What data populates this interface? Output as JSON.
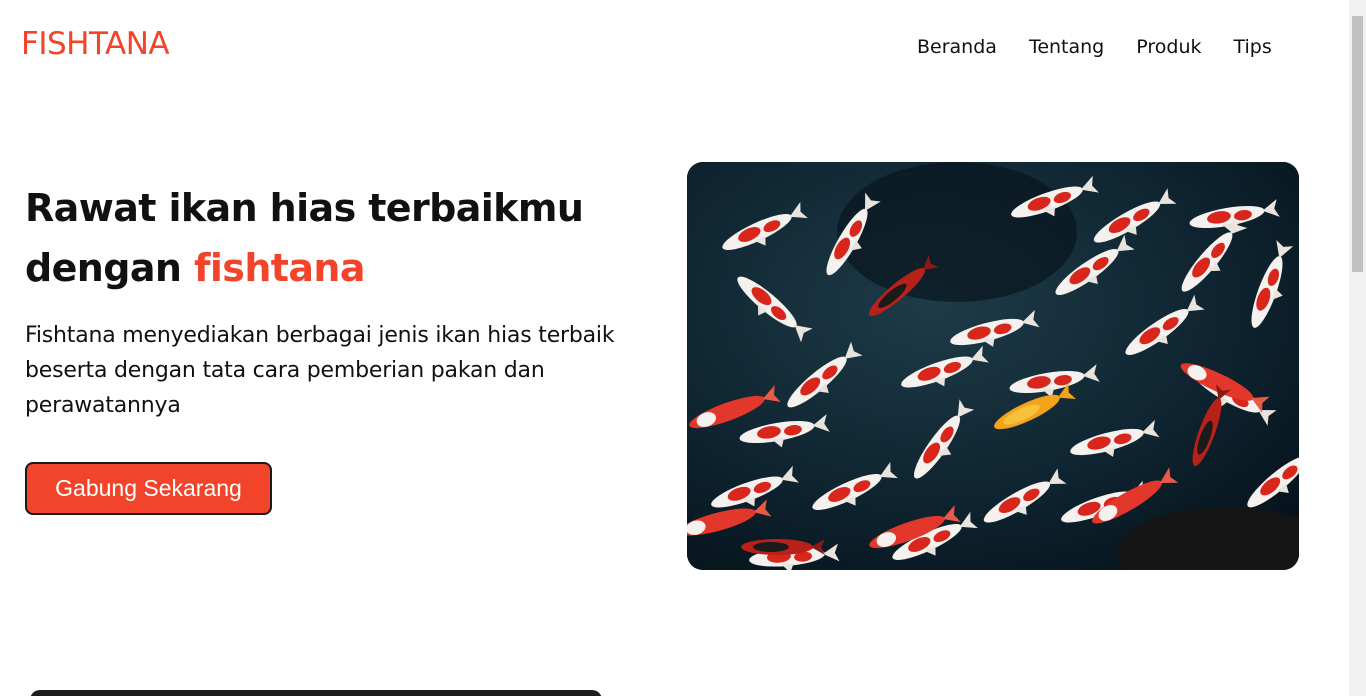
{
  "brand": {
    "logo": "FISHTANA"
  },
  "nav": {
    "items": [
      "Beranda",
      "Tentang",
      "Produk",
      "Tips"
    ]
  },
  "hero": {
    "title_line1": "Rawat ikan hias terbaikmu",
    "title_line2_prefix": "dengan ",
    "title_accent": "fishtana",
    "description": "Fishtana menyediakan berbagai jenis ikan hias terbaik beserta dengan tata cara pemberian pakan dan perawatannya",
    "cta_label": "Gabung Sekarang",
    "image_subject": "koi-fish-pond"
  },
  "colors": {
    "accent": "#f2442a",
    "text": "#111111",
    "button_border": "#1a1a1a",
    "water": "#0c1d26"
  }
}
